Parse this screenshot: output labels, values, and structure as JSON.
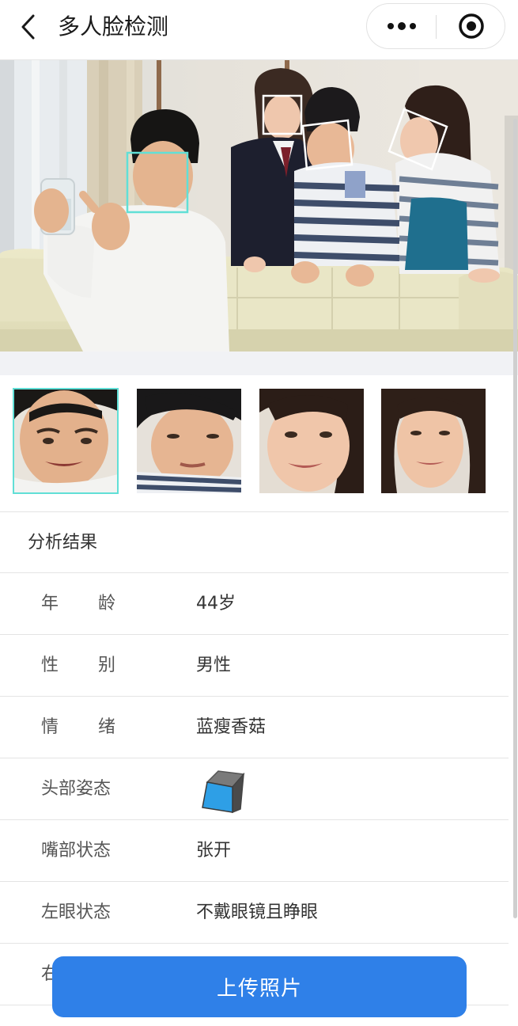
{
  "navbar": {
    "title": "多人脸检测",
    "back_icon": "chevron-left-icon",
    "more_icon": "more-dots-icon",
    "close_icon": "target-circle-icon"
  },
  "photo": {
    "face_box_colors": {
      "selected": "#61dfd6",
      "other": "#ffffff"
    }
  },
  "thumbnails": [
    {
      "name": "face-1",
      "selected": true
    },
    {
      "name": "face-2",
      "selected": false
    },
    {
      "name": "face-3",
      "selected": false
    },
    {
      "name": "face-4",
      "selected": false
    }
  ],
  "results": {
    "header": "分析结果",
    "rows": [
      {
        "label_chars": [
          "年",
          "龄"
        ],
        "value": "44岁"
      },
      {
        "label_chars": [
          "性",
          "别"
        ],
        "value": "男性"
      },
      {
        "label_chars": [
          "情",
          "绪"
        ],
        "value": "蓝瘦香菇"
      },
      {
        "label": "头部姿态",
        "value_icon": "head-pose-cube-icon"
      },
      {
        "label": "嘴部状态",
        "value": "张开"
      },
      {
        "label": "左眼状态",
        "value": "不戴眼镜且睁眼"
      },
      {
        "label": "右"
      }
    ]
  },
  "upload_button": {
    "label": "上传照片"
  },
  "colors": {
    "accent": "#2f80e8",
    "selected_outline": "#61dfd6",
    "divider": "#e4e4e4"
  }
}
